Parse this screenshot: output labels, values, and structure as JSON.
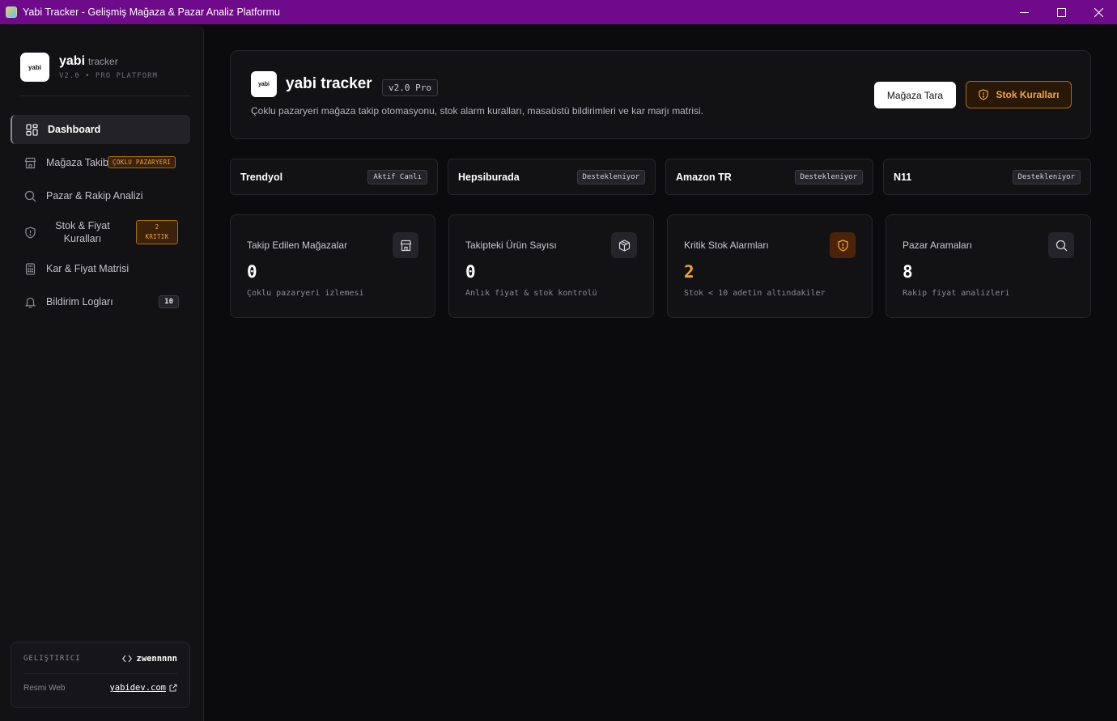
{
  "window": {
    "title": "Yabi Tracker - Gelişmiş Mağaza & Pazar Analiz Platformu"
  },
  "sidebar": {
    "logo_text": "yabi",
    "brand_name": "yabi",
    "brand_sub": "tracker",
    "brand_version": "V2.0 • PRO PLATFORM",
    "items": [
      {
        "label": "Dashboard",
        "icon": "dashboard-grid-icon"
      },
      {
        "label": "Mağaza Takibi",
        "icon": "store-icon",
        "badge": "ÇOKLU PAZARYERI"
      },
      {
        "label": "Pazar & Rakip Analizi",
        "icon": "search-icon"
      },
      {
        "label": "Stok & Fiyat Kuralları",
        "icon": "shield-alert-icon",
        "badge_line1": "2",
        "badge_line2": "KRITIK"
      },
      {
        "label": "Kar & Fiyat Matrisi",
        "icon": "calculator-icon"
      },
      {
        "label": "Bildirim Logları",
        "icon": "bell-icon",
        "count": "10"
      }
    ],
    "developer": {
      "label": "GELIŞTIRICI",
      "name": "zwennnnn",
      "web_label": "Resmi Web",
      "web_link": "yabidev.com"
    }
  },
  "hero": {
    "logo_text": "yabi",
    "title": "yabi tracker",
    "version": "v2.0 Pro",
    "description": "Çoklu pazaryeri mağaza takip otomasyonu, stok alarm kuralları, masaüstü bildirimleri ve kar marjı matrisi.",
    "scan_button": "Mağaza Tara",
    "rules_button": "Stok Kuralları"
  },
  "markets": [
    {
      "name": "Trendyol",
      "status": "Aktif Canlı"
    },
    {
      "name": "Hepsiburada",
      "status": "Destekleniyor"
    },
    {
      "name": "Amazon TR",
      "status": "Destekleniyor"
    },
    {
      "name": "N11",
      "status": "Destekleniyor"
    }
  ],
  "stats": [
    {
      "label": "Takip Edilen Mağazalar",
      "value": "0",
      "desc": "Çoklu pazaryeri izlemesi",
      "icon": "store-icon"
    },
    {
      "label": "Takipteki Ürün Sayısı",
      "value": "0",
      "desc": "Anlık fiyat & stok kontrolü",
      "icon": "package-icon"
    },
    {
      "label": "Kritik Stok Alarmları",
      "value": "2",
      "desc": "Stok < 10 adetin altındakiler",
      "icon": "shield-alert-icon"
    },
    {
      "label": "Pazar Aramaları",
      "value": "8",
      "desc": "Rakip fiyat analizleri",
      "icon": "search-icon"
    }
  ],
  "colors": {
    "titlebar": "#6f0a8a",
    "accent_warn": "#f5a623",
    "background": "#0b0b0d"
  }
}
